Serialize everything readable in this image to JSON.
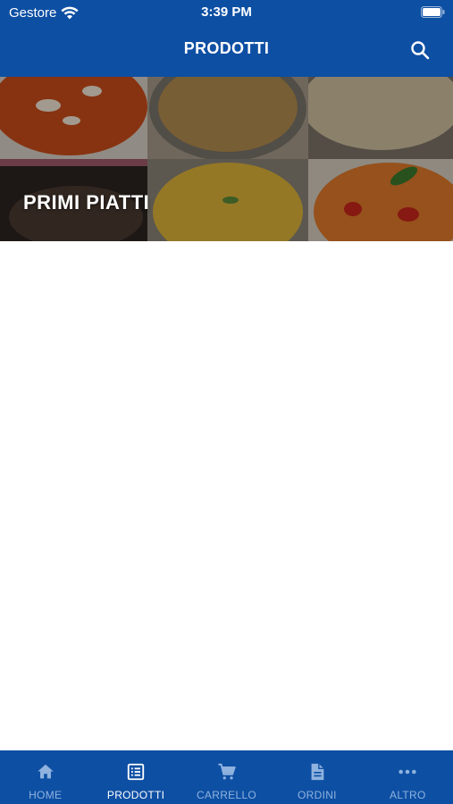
{
  "status_bar": {
    "carrier": "Gestore",
    "time": "3:39 PM"
  },
  "nav": {
    "title": "PRODOTTI",
    "search_icon": "search-icon"
  },
  "categories": [
    {
      "label": "PRIMI PIATTI"
    }
  ],
  "tab_bar": {
    "active_tab": "PRODOTTI",
    "tabs": [
      {
        "label": "HOME",
        "icon": "home-icon"
      },
      {
        "label": "PRODOTTI",
        "icon": "list-icon"
      },
      {
        "label": "CARRELLO",
        "icon": "cart-icon"
      },
      {
        "label": "ORDINI",
        "icon": "document-icon"
      },
      {
        "label": "ALTRO",
        "icon": "more-icon"
      }
    ]
  },
  "colors": {
    "brand_blue": "#0d4fa3",
    "tab_inactive": "#8fb2df",
    "tab_active": "#ffffff",
    "background": "#ffffff"
  }
}
